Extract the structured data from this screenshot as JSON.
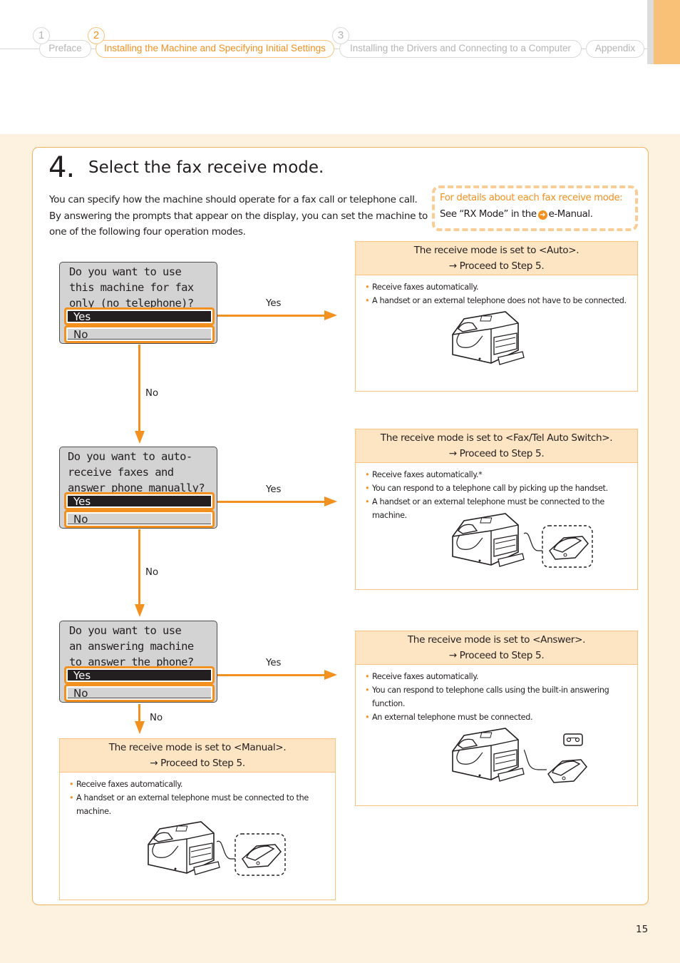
{
  "nav": {
    "tabs": [
      {
        "number": "1",
        "label": "Preface",
        "active": false
      },
      {
        "number": "2",
        "label": "Installing the Machine and Specifying Initial Settings",
        "active": true
      },
      {
        "number": "3",
        "label": "Installing the Drivers and Connecting to a Computer",
        "active": false
      },
      {
        "number": "",
        "label": "Appendix",
        "active": false
      }
    ]
  },
  "step": {
    "number": "4.",
    "title": "Select the fax receive mode.",
    "intro": "You can specify how the machine should operate for a fax call or telephone call. By answering the prompts that appear on the display, you can set the machine to one of the following four operation modes."
  },
  "details": {
    "title": "For details about each fax receive mode:",
    "text_before": "See “RX Mode” in the",
    "icon": "arrow-circle-icon",
    "text_after": "e-Manual."
  },
  "dialogs": [
    {
      "question": "Do you want to use\nthis machine for fax\nonly (no telephone)?",
      "yes": "Yes",
      "no": "No"
    },
    {
      "question": "Do you want to auto-\nreceive faxes and\nanswer phone manually?",
      "yes": "Yes",
      "no": "No"
    },
    {
      "question": "Do you want to use\nan answering machine\nto answer the phone?",
      "yes": "Yes",
      "no": "No"
    }
  ],
  "flow_labels": {
    "yes": "Yes",
    "no": "No"
  },
  "results": [
    {
      "title": "The receive mode is set to <Auto>.",
      "proceed": "→ Proceed to Step 5.",
      "bullets": [
        "Receive faxes automatically.",
        "A handset or an external telephone does not have to be connected."
      ],
      "illustration": "fax-machine"
    },
    {
      "title": "The receive mode is set to <Fax/Tel Auto Switch>.",
      "proceed": "→ Proceed to Step 5.",
      "bullets": [
        "Receive faxes automatically.*",
        "You can respond to a telephone call by picking up the handset.",
        "A handset or an external telephone must be connected to the machine."
      ],
      "illustration": "fax-machine-with-telephone"
    },
    {
      "title": "The receive mode is set to <Answer>.",
      "proceed": "→ Proceed to Step 5.",
      "bullets": [
        "Receive faxes automatically.",
        "You can respond to telephone calls using the built-in answering function.",
        "An external telephone must be connected."
      ],
      "illustration": "fax-machine-with-answering-machine"
    },
    {
      "title": "The receive mode is set to <Manual>.",
      "proceed": "→ Proceed to Step 5.",
      "bullets": [
        "Receive faxes automatically.",
        "A handset or an external telephone must be connected to the machine."
      ],
      "illustration": "fax-machine-with-telephone"
    }
  ],
  "colors": {
    "accent": "#f39120",
    "band": "#fdf1df",
    "result_header": "#fde5c4",
    "border": "#f6b15f"
  },
  "page_number": "15"
}
